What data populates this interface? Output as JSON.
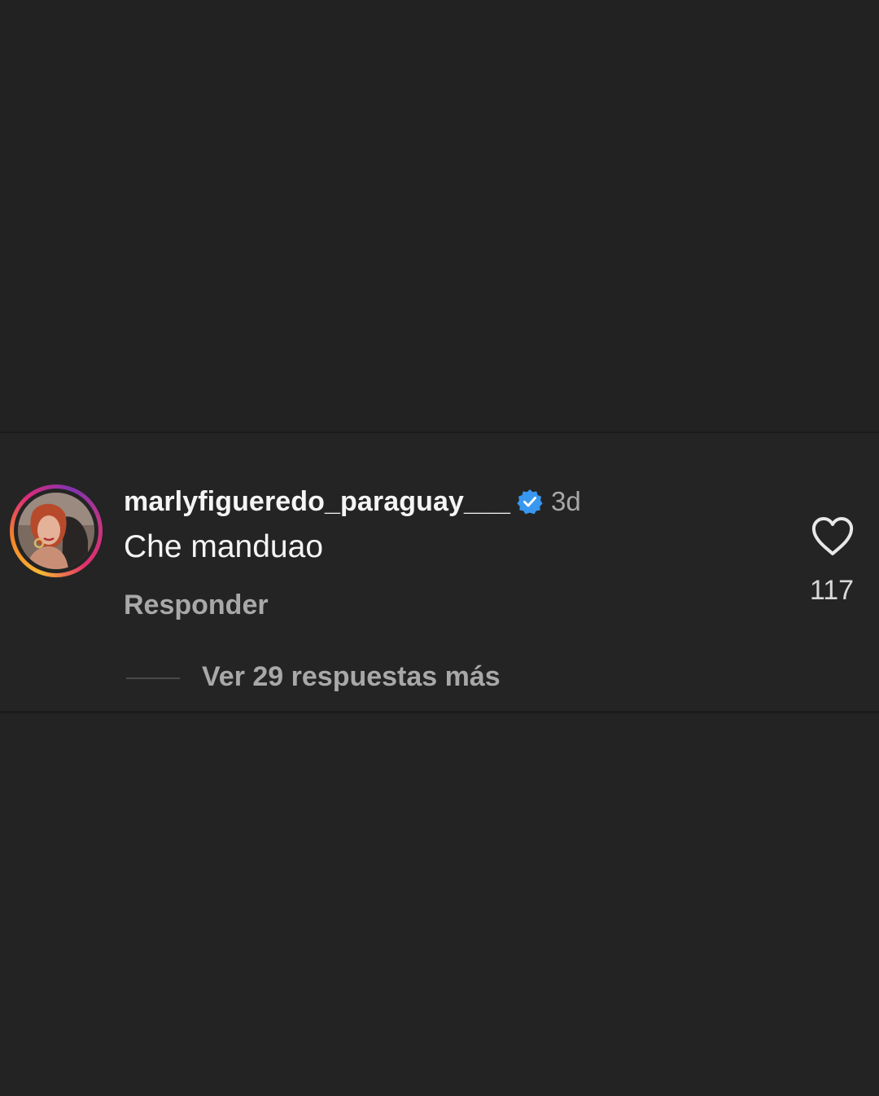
{
  "comment": {
    "username": "marlyfigueredo_paraguay___",
    "verified_icon": "verified-badge-icon",
    "time_ago": "3d",
    "text": "Che manduao",
    "reply_label": "Responder",
    "like_count": "117",
    "view_replies_label": "Ver 29 respuestas más"
  },
  "colors": {
    "background": "#232323",
    "primary_text": "#f5f5f5",
    "secondary_text": "#a8a8a8",
    "verified_blue": "#3897f0"
  }
}
